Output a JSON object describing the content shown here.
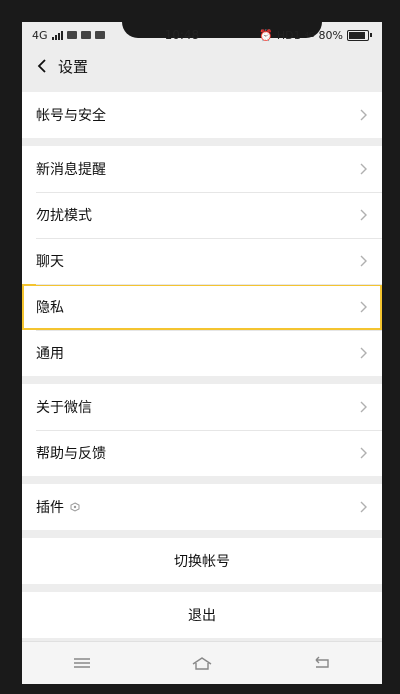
{
  "status": {
    "network": "4G",
    "time": "10:48",
    "right_label": "HD1",
    "right_sup": "4G",
    "battery": "80%",
    "battery_level": 0.8
  },
  "header": {
    "title": "设置"
  },
  "groups": [
    {
      "items": [
        {
          "label": "帐号与安全"
        }
      ]
    },
    {
      "items": [
        {
          "label": "新消息提醒"
        },
        {
          "label": "勿扰模式"
        },
        {
          "label": "聊天"
        },
        {
          "label": "隐私"
        },
        {
          "label": "通用"
        }
      ]
    },
    {
      "items": [
        {
          "label": "关于微信"
        },
        {
          "label": "帮助与反馈"
        }
      ]
    },
    {
      "items": [
        {
          "label": "插件"
        }
      ]
    }
  ],
  "actions": {
    "switch_account": "切换帐号",
    "logout": "退出"
  },
  "colors": {
    "highlight": "#f4c430",
    "background": "#ededed"
  },
  "icons": {
    "back": "chevron-left-icon",
    "row_arrow": "chevron-right-icon",
    "plugin": "plugin-icon",
    "nav_menu": "menu-icon",
    "nav_home": "home-icon",
    "nav_back": "back-icon"
  }
}
